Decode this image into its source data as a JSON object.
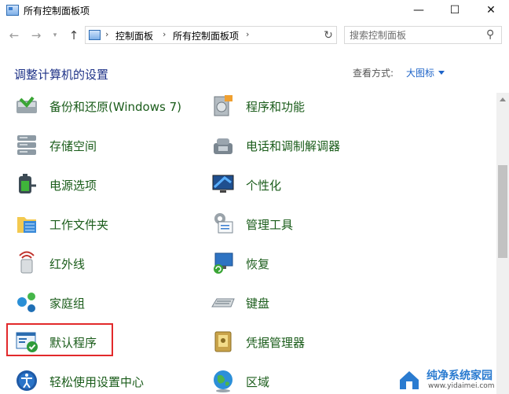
{
  "window": {
    "title": "所有控制面板项"
  },
  "controls": {
    "minimize": "—",
    "maximize": "☐",
    "close": "✕"
  },
  "address": {
    "crumbs": [
      "控制面板",
      "所有控制面板项"
    ],
    "separator": "›",
    "chevron": "⌄",
    "refresh": "↻"
  },
  "search": {
    "placeholder": "搜索控制面板"
  },
  "header": {
    "title": "调整计算机的设置",
    "view_by_label": "查看方式:",
    "view_by_value": "大图标"
  },
  "items_left": [
    {
      "label": "备份和还原(Windows 7)",
      "icon": "backup-restore-icon"
    },
    {
      "label": "存储空间",
      "icon": "storage-spaces-icon"
    },
    {
      "label": "电源选项",
      "icon": "power-options-icon"
    },
    {
      "label": "工作文件夹",
      "icon": "work-folders-icon"
    },
    {
      "label": "红外线",
      "icon": "infrared-icon"
    },
    {
      "label": "家庭组",
      "icon": "homegroup-icon"
    },
    {
      "label": "默认程序",
      "icon": "default-programs-icon"
    },
    {
      "label": "轻松使用设置中心",
      "icon": "ease-of-access-icon"
    }
  ],
  "items_right": [
    {
      "label": "程序和功能",
      "icon": "programs-features-icon"
    },
    {
      "label": "电话和调制解调器",
      "icon": "phone-modem-icon"
    },
    {
      "label": "个性化",
      "icon": "personalization-icon"
    },
    {
      "label": "管理工具",
      "icon": "admin-tools-icon"
    },
    {
      "label": "恢复",
      "icon": "recovery-icon"
    },
    {
      "label": "键盘",
      "icon": "keyboard-icon"
    },
    {
      "label": "凭据管理器",
      "icon": "credential-manager-icon"
    },
    {
      "label": "区域",
      "icon": "region-icon"
    }
  ],
  "highlight": {
    "item": "默认程序",
    "color": "#e2292b"
  },
  "watermark": {
    "text": "纯净系统家园",
    "url": "www.yidaimei.com"
  },
  "colors": {
    "link": "#1a5c1a",
    "heading": "#1e3287",
    "accent": "#1e64c8"
  }
}
